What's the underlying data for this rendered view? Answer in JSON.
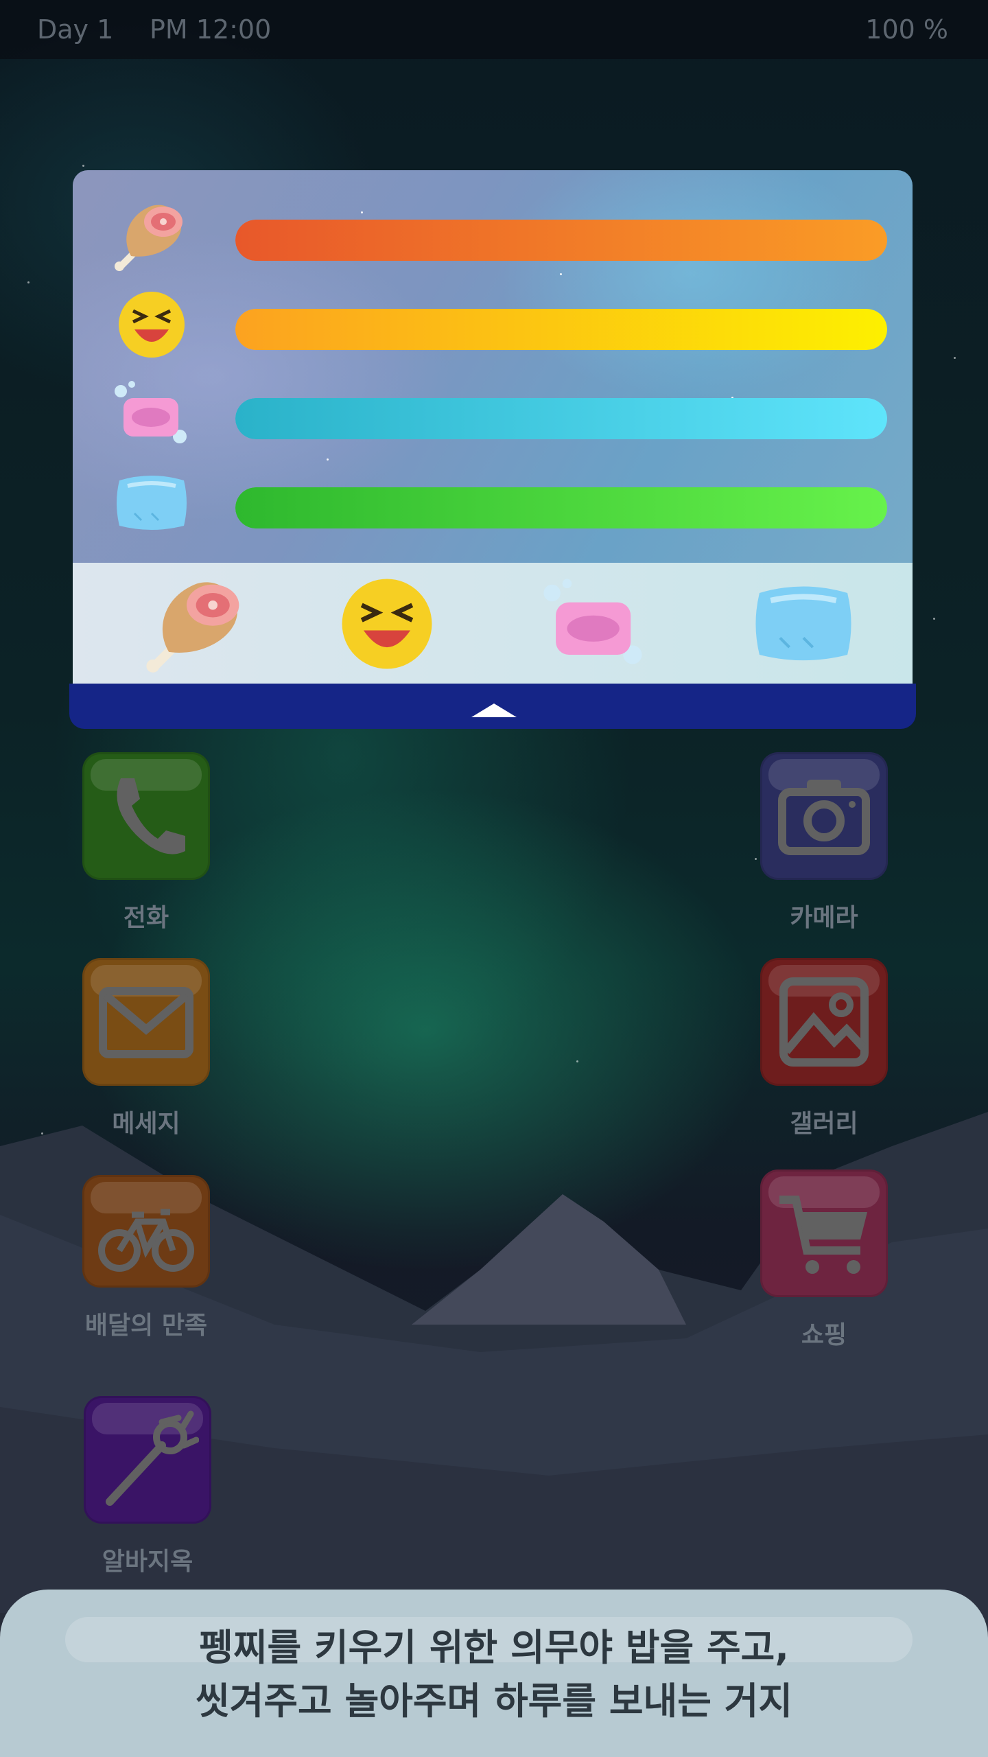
{
  "status_bar": {
    "day": "Day 1",
    "time": "PM 12:00",
    "battery": "100 %"
  },
  "stats_panel": {
    "stats": [
      {
        "name": "hunger",
        "icon": "meat-icon",
        "level": 1.0,
        "colors": [
          "#e8582a",
          "#fa9c26"
        ]
      },
      {
        "name": "happiness",
        "icon": "laughing-face-icon",
        "level": 1.0,
        "colors": [
          "#fca220",
          "#fdf000"
        ]
      },
      {
        "name": "cleanliness",
        "icon": "soap-icon",
        "level": 1.0,
        "colors": [
          "#2ab2c9",
          "#5fe4fb"
        ]
      },
      {
        "name": "sleep",
        "icon": "pillow-icon",
        "level": 1.0,
        "colors": [
          "#2eb82e",
          "#67f24b"
        ]
      }
    ],
    "actions": [
      "feed-button",
      "play-button",
      "wash-button",
      "sleep-button"
    ]
  },
  "apps": [
    {
      "id": "phone",
      "label": "전화",
      "icon": "phone-icon",
      "color": "#255c17"
    },
    {
      "id": "camera",
      "label": "카메라",
      "icon": "camera-icon",
      "color": "#2a2d5e"
    },
    {
      "id": "message",
      "label": "메세지",
      "icon": "mail-icon",
      "color": "#7a4d14"
    },
    {
      "id": "gallery",
      "label": "갤러리",
      "icon": "image-icon",
      "color": "#6e1d1d"
    },
    {
      "id": "delivery",
      "label": "배달의 만족",
      "icon": "bicycle-icon",
      "color": "#6e3b14"
    },
    {
      "id": "shopping",
      "label": "쇼핑",
      "icon": "cart-icon",
      "color": "#6e2440"
    },
    {
      "id": "alba",
      "label": "알바지옥",
      "icon": "pitchfork-icon",
      "color": "#3a1466"
    }
  ],
  "dialog": {
    "line1": "펭찌를 키우기 위한 의무야 밥을 주고,",
    "line2": "씻겨주고 놀아주며 하루를 보내는 거지"
  }
}
